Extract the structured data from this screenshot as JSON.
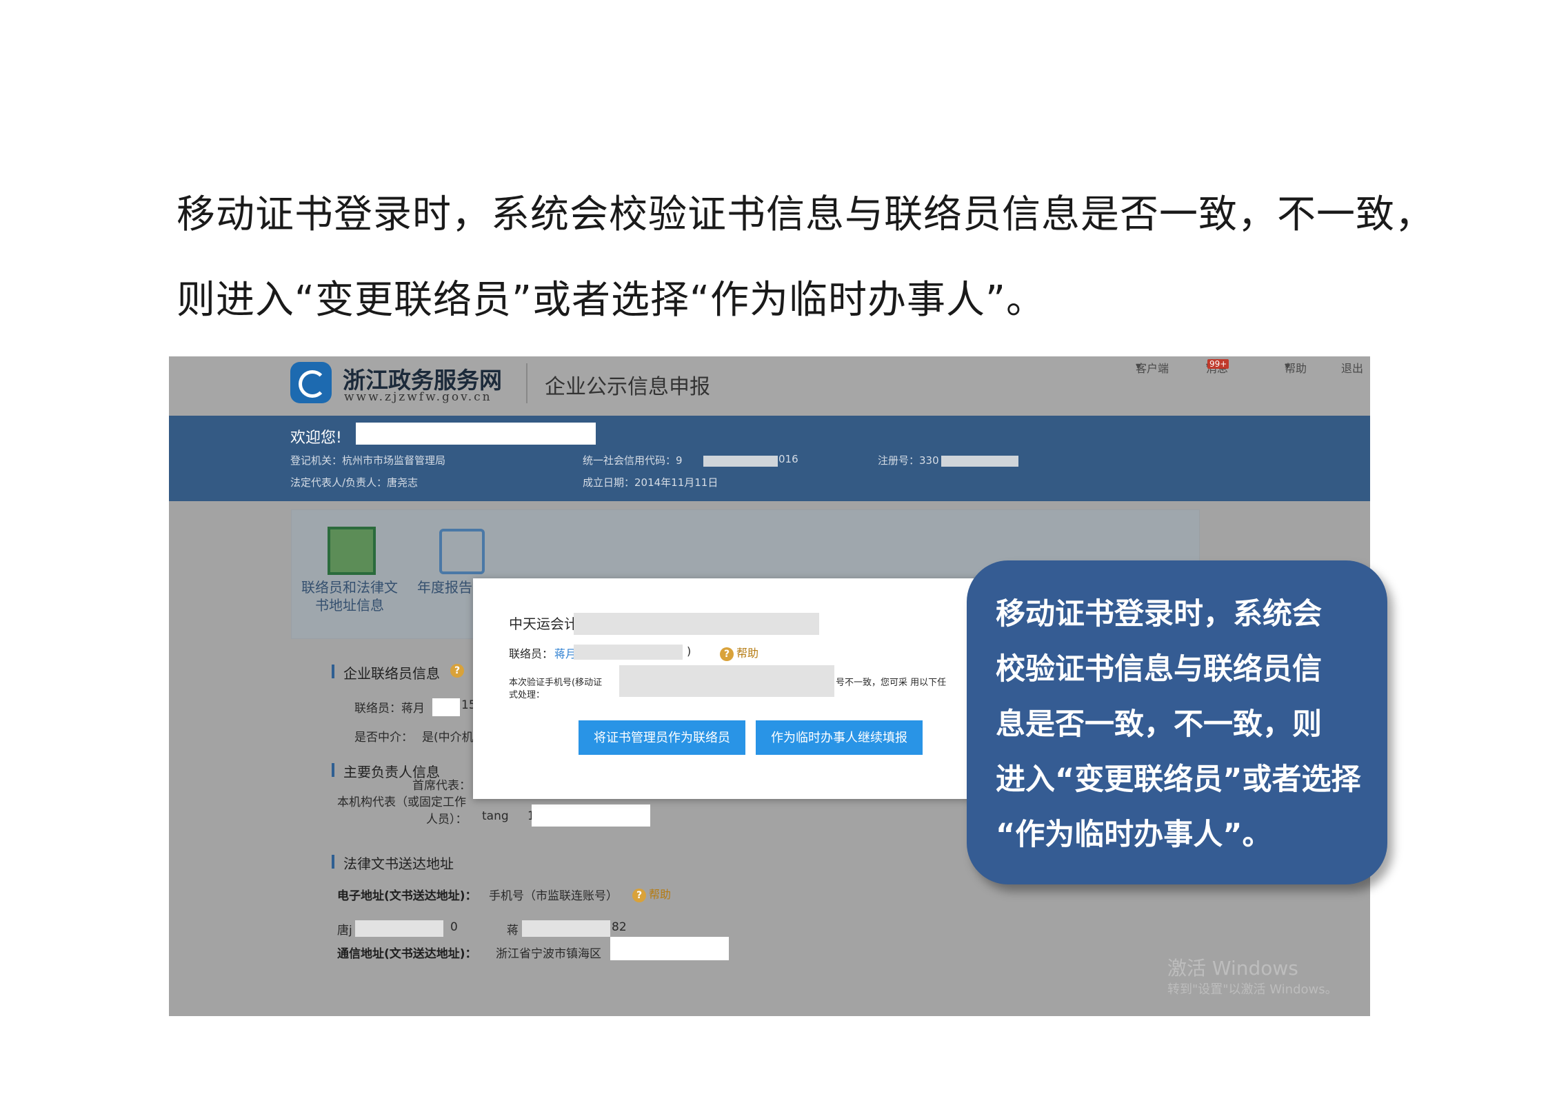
{
  "intro": {
    "line1": "移动证书登录时，系统会校验证书信息与联络员信息是否一致，不一致，",
    "line2": "则进入“变更联络员”或者选择“作为临时办事人”。"
  },
  "site": {
    "brand_name": "浙江政务服务网",
    "brand_url": "www.zjzwfw.gov.cn",
    "portal_title": "企业公示信息申报",
    "top_links": {
      "client": "客户端",
      "messages": "消息",
      "badge": "99+",
      "help": "帮助",
      "logout": "退出"
    }
  },
  "bluebar": {
    "welcome": "欢迎您!",
    "reg_authority": "登记机关：杭州市市场监督管理局",
    "credit_code_prefix": "统一社会信用代码：9",
    "credit_code_suffix": "016",
    "reg_no_prefix": "注册号：330",
    "legal_rep": "法定代表人/负责人：唐尧志",
    "established": "成立日期：2014年11月11日"
  },
  "panel": {
    "item1_line1": "联络员和法律文",
    "item1_line2": "书地址信息",
    "item2": "年度报告"
  },
  "content": {
    "sec_contact": "企业联络员信息",
    "contact_label": "联络员：蒋月",
    "contact_num": "15",
    "intermediary": "是否中介：",
    "intermediary_val": "是(中介机",
    "sec_principal": "主要负责人信息",
    "chief_rep": "首席代表：",
    "org_rep_line1": "本机构代表（或固定工作",
    "org_rep_line2": "人员）：",
    "org_rep_val": "tang",
    "org_rep_num": "1",
    "sec_legal": "法律文书送达地址",
    "e_addr_label": "电子地址(文书送达地址)：",
    "e_addr_val": "手机号（市监联连账号）",
    "help": "帮助",
    "row_a1": "唐j",
    "row_a2": "0",
    "row_b1": "蒋",
    "row_b2": "82",
    "mail_label": "通信地址(文书送达地址)：",
    "mail_val": "浙江省宁波市镇海区"
  },
  "modal": {
    "company": "中天运会计",
    "contact_label": "联络员：",
    "contact_val": "蒋月",
    "paren": ")",
    "help": "帮助",
    "msg_prefix": "本次验证手机号(移动证",
    "msg_mid": "号不一致，您可采 用以下任",
    "msg_line2": "式处理：",
    "btn_set_contact": "将证书管理员作为联络员",
    "btn_temp": "作为临时办事人继续填报"
  },
  "watermark": {
    "line1": "激活 Windows",
    "line2": "转到\"设置\"以激活 Windows。"
  },
  "callout": {
    "line1": "移动证书登录时，系统会",
    "line2": "校验证书信息与联络员信",
    "line3": "息是否一致，不一致，则",
    "line4": "进入“变更联络员”或者选择",
    "line5": "“作为临时办事人”。"
  }
}
